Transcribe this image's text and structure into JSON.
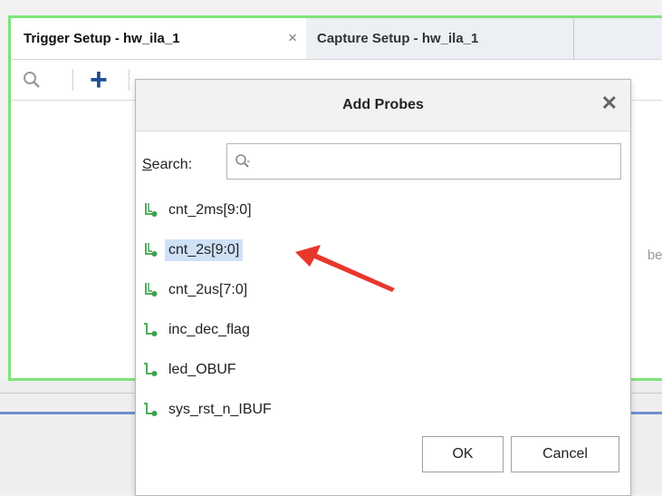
{
  "tabs": [
    {
      "label": "Trigger Setup - hw_ila_1",
      "close": "×"
    },
    {
      "label": "Capture Setup - hw_ila_1"
    }
  ],
  "background": {
    "side_text": "bes"
  },
  "dialog": {
    "title": "Add Probes",
    "close": "✕",
    "search_label_accel": "S",
    "search_label_rest": "earch:",
    "search_value": "",
    "probes": [
      {
        "label": "cnt_2ms[9:0]",
        "icon": "bus-probe-icon"
      },
      {
        "label": "cnt_2s[9:0]",
        "icon": "bus-probe-icon",
        "selected": true
      },
      {
        "label": "cnt_2us[7:0]",
        "icon": "bus-probe-icon"
      },
      {
        "label": "inc_dec_flag",
        "icon": "signal-probe-icon"
      },
      {
        "label": "led_OBUF",
        "icon": "signal-probe-icon"
      },
      {
        "label": "sys_rst_n_IBUF",
        "icon": "signal-probe-icon"
      }
    ],
    "ok_label": "OK",
    "cancel_label": "Cancel"
  },
  "colors": {
    "panel_border": "#7ee37a",
    "selection": "#cfe1f7",
    "arrow": "#e8372c",
    "probe_icon": "#3aa34a",
    "plus": "#1f4f93"
  }
}
